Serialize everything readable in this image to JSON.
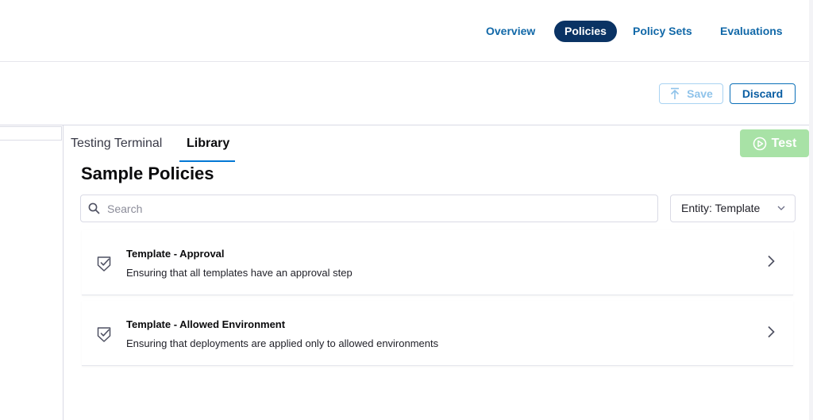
{
  "header": {
    "nav": [
      {
        "label": "Overview",
        "active": false
      },
      {
        "label": "Policies",
        "active": true
      },
      {
        "label": "Policy Sets",
        "active": false
      },
      {
        "label": "Evaluations",
        "active": false
      }
    ]
  },
  "toolbar": {
    "save_label": "Save",
    "discard_label": "Discard"
  },
  "panel": {
    "tabs": [
      {
        "label": "Testing Terminal",
        "active": false
      },
      {
        "label": "Library",
        "active": true
      }
    ],
    "test_label": "Test",
    "section_title": "Sample Policies",
    "search_placeholder": "Search",
    "entity_select": "Entity: Template",
    "policies": [
      {
        "title": "Template - Approval",
        "description": "Ensuring that all templates have an approval step"
      },
      {
        "title": "Template - Allowed Environment",
        "description": "Ensuring that deployments are applied only to allowed environments"
      }
    ]
  },
  "colors": {
    "nav_active_bg": "#0a3364",
    "link": "#1168a8",
    "tab_underline": "#0278d5",
    "test_button": "#a8e2a6"
  },
  "icons": [
    "arrow-up-save-icon",
    "play-circle-icon",
    "search-icon",
    "chevron-down-icon",
    "shield-check-icon",
    "chevron-right-icon"
  ]
}
